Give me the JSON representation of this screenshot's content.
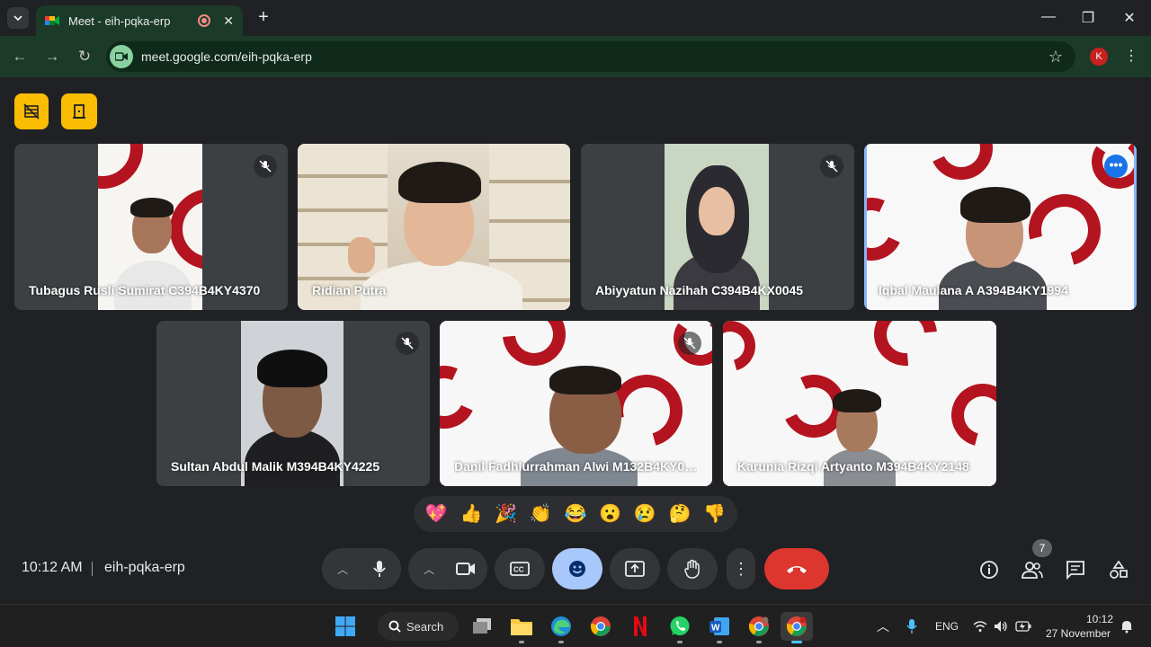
{
  "browser": {
    "tab_title": "Meet - eih-pqka-erp",
    "url": "meet.google.com/eih-pqka-erp",
    "profile_initial": "K"
  },
  "participants": [
    {
      "name": "Tubagus Rusli Sumirat C394B4KY4370",
      "muted": true
    },
    {
      "name": "Ridian Putra",
      "muted": false
    },
    {
      "name": "Abiyyatun Nazihah C394B4KX0045",
      "muted": true
    },
    {
      "name": "Iqbal Maulana A A394B4KY1994",
      "muted": false,
      "active": true
    },
    {
      "name": "Sultan Abdul Malik M394B4KY4225",
      "muted": true
    },
    {
      "name": "Danil Fadhlurrahman Alwi M132B4KY0…",
      "muted": true
    },
    {
      "name": "Karunia Rizqi Artyanto M394B4KY2148",
      "muted": false
    }
  ],
  "reactions": [
    "💖",
    "👍",
    "🎉",
    "👏",
    "😂",
    "😮",
    "😢",
    "🤔",
    "👎"
  ],
  "controls": {
    "time": "10:12 AM",
    "meeting_code": "eih-pqka-erp",
    "participant_count": "7"
  },
  "taskbar": {
    "search_label": "Search",
    "lang": "ENG",
    "time": "10:12",
    "date": "27 November"
  },
  "colors": {
    "meet_bg": "#202124",
    "tab_green": "#1b3a27",
    "end_call": "#dc362e",
    "host_yellow": "#fbbc04",
    "active_blue": "#8ab4f8"
  }
}
